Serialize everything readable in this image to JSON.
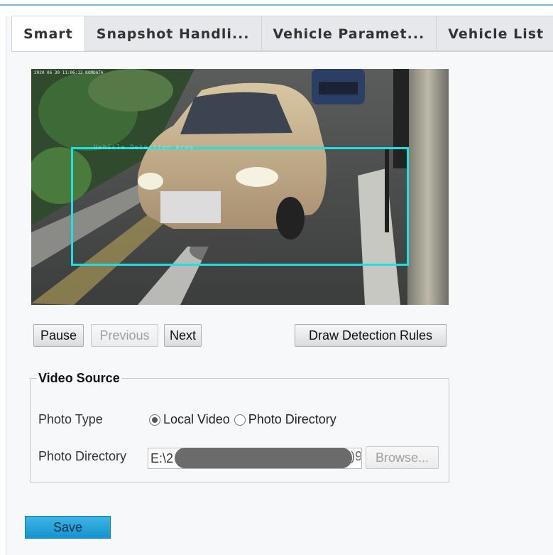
{
  "tabs": [
    {
      "label": "Smart",
      "active": true
    },
    {
      "label": "Snapshot Handli...",
      "active": false
    },
    {
      "label": "Vehicle Paramet...",
      "active": false
    },
    {
      "label": "Vehicle List",
      "active": false
    }
  ],
  "video": {
    "osd_text": "2020 06 30 11:06:12 KOMDATA",
    "detection_label": "Vehicle Detection Area",
    "detection_box_color": "#1ee0e0"
  },
  "controls": {
    "pause": "Pause",
    "previous": "Previous",
    "next": "Next",
    "draw_rules": "Draw Detection Rules"
  },
  "video_source": {
    "legend": "Video Source",
    "photo_type_label": "Photo Type",
    "options": [
      {
        "label": "Local Video",
        "selected": true
      },
      {
        "label": "Photo Directory",
        "selected": false
      }
    ],
    "photo_directory_label": "Photo Directory",
    "photo_directory_value": "E:\\2",
    "photo_directory_tail": ")9",
    "browse": "Browse..."
  },
  "save": "Save",
  "colors": {
    "accent": "#1593cf",
    "tab_active_bg": "#ffffff",
    "tab_bg": "#e6e8eb"
  }
}
